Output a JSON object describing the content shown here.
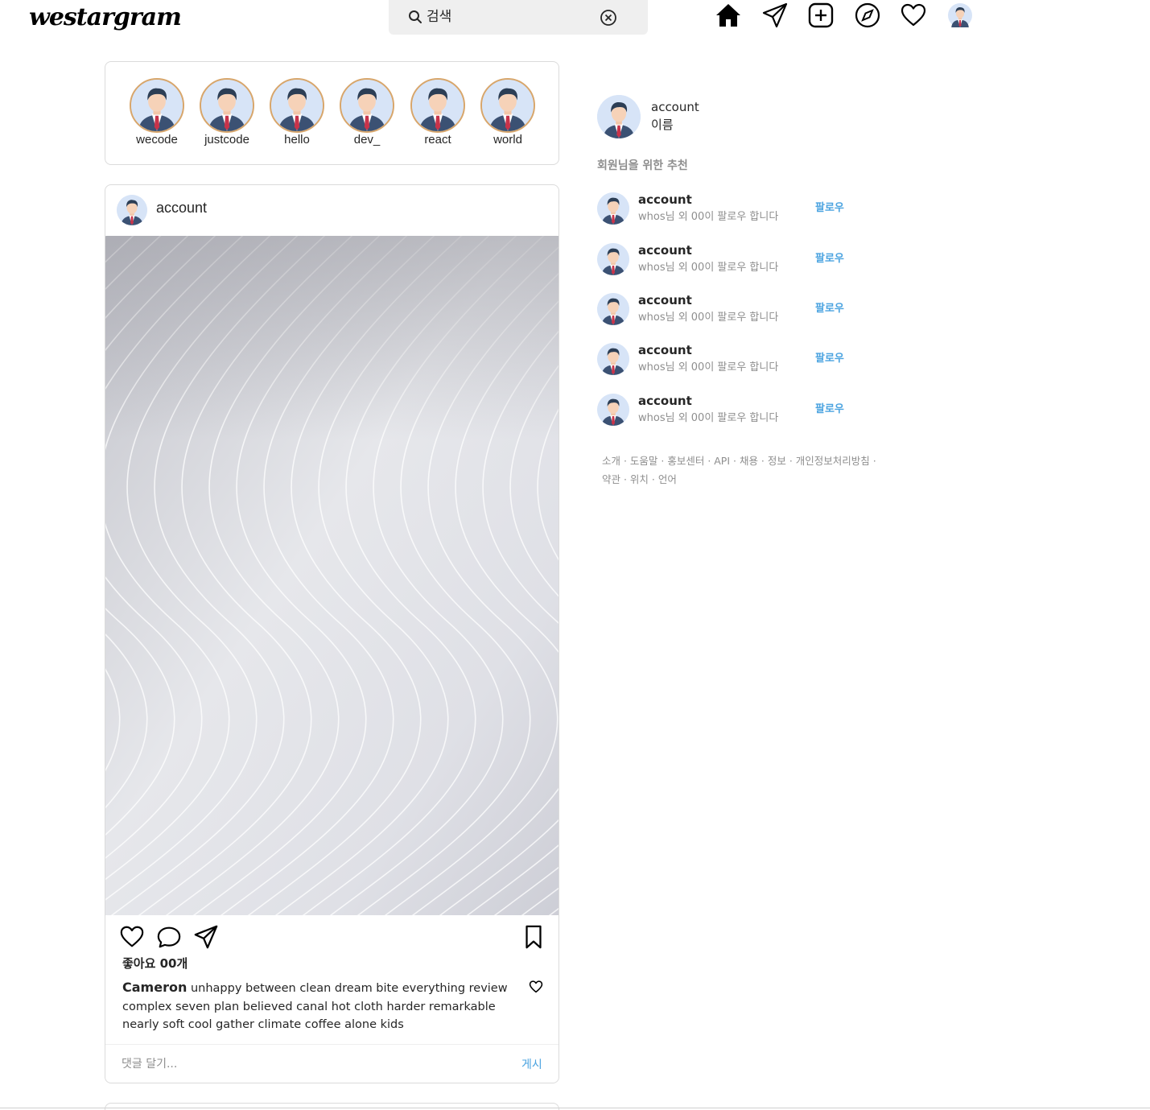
{
  "header": {
    "logo": "westargram",
    "search_placeholder": "검색",
    "nav_icons": [
      "home-icon",
      "direct-icon",
      "new-post-icon",
      "explore-icon",
      "activity-icon",
      "profile-avatar"
    ]
  },
  "stories": [
    {
      "name": "wecode"
    },
    {
      "name": "justcode"
    },
    {
      "name": "hello"
    },
    {
      "name": "dev_"
    },
    {
      "name": "react"
    },
    {
      "name": "world"
    }
  ],
  "post": {
    "username": "account",
    "likes": "좋아요 00개",
    "caption_author": "Cameron",
    "caption_text": "unhappy between clean dream bite everything review complex seven plan believed canal hot cloth harder remarkable nearly soft cool gather climate coffee alone kids",
    "comment_placeholder": "댓글 달기...",
    "post_button": "게시"
  },
  "sidebar": {
    "my_username": "account",
    "my_name": "이름",
    "recommend_title": "회원님을 위한 추천",
    "recommendations": [
      {
        "username": "account",
        "sub": "whos님 외 00이 팔로우 합니다",
        "follow": "팔로우"
      },
      {
        "username": "account",
        "sub": "whos님 외 00이 팔로우 합니다",
        "follow": "팔로우"
      },
      {
        "username": "account",
        "sub": "whos님 외 00이 팔로우 합니다",
        "follow": "팔로우"
      },
      {
        "username": "account",
        "sub": "whos님 외 00이 팔로우 합니다",
        "follow": "팔로우"
      },
      {
        "username": "account",
        "sub": "whos님 외 00이 팔로우 합니다",
        "follow": "팔로우"
      }
    ],
    "footer_line1": "소개 · 도움말 · 홍보센터 · API · 채용 · 정보 · 개인정보처리방침 ·",
    "footer_line2": "약관 · 위치 · 언어"
  },
  "colors": {
    "link_blue": "#4aa3e0",
    "story_ring": "#d8a66b",
    "border": "#dbdbdb",
    "muted_text": "#8e8e8e"
  }
}
